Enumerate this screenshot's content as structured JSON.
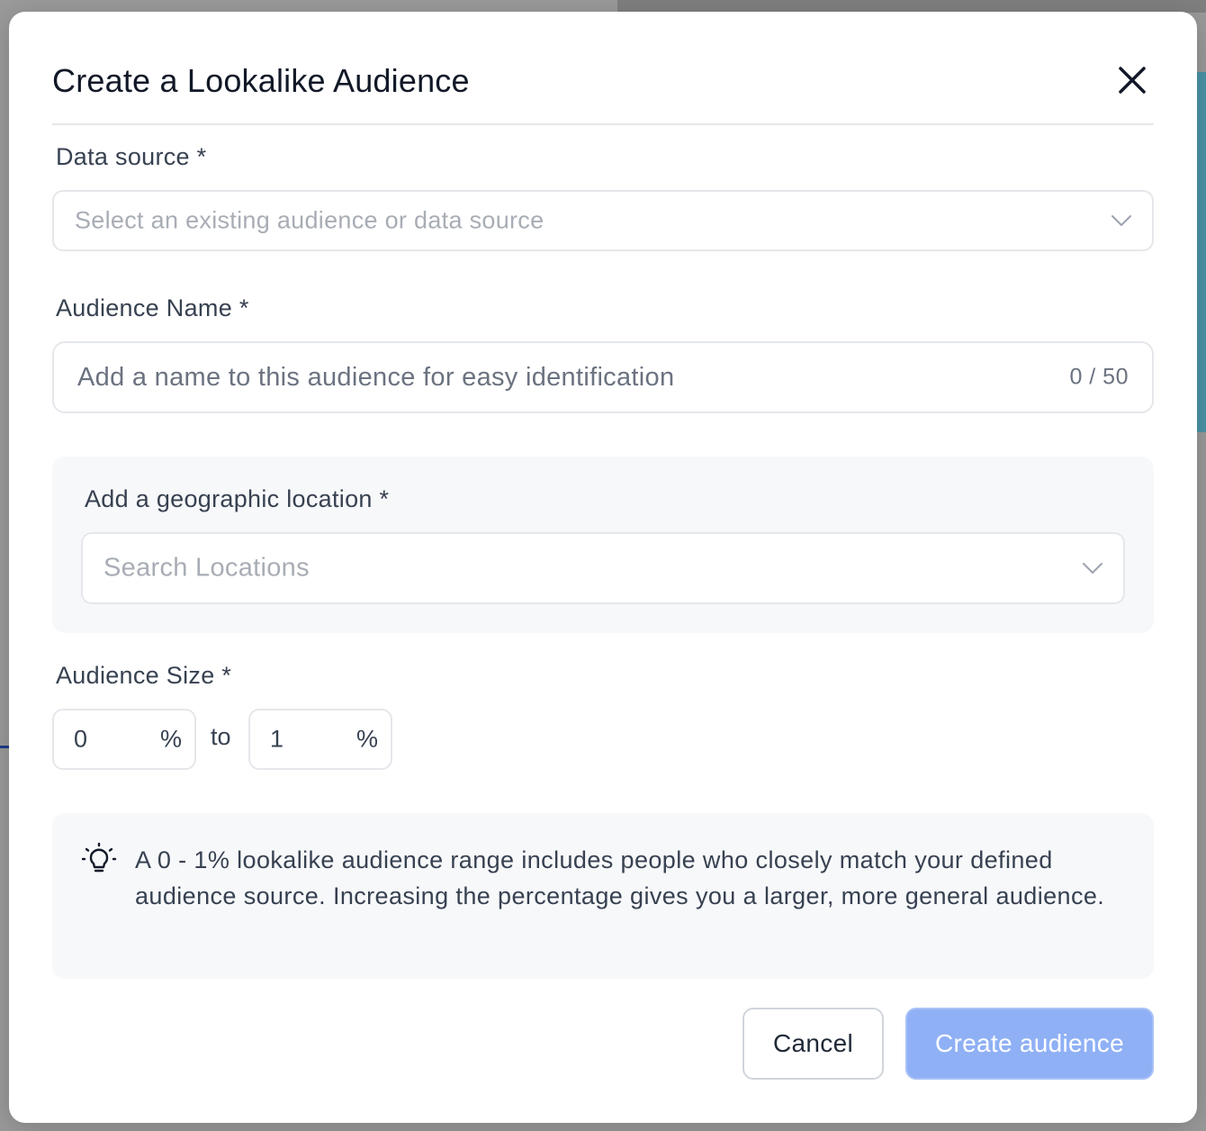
{
  "modal": {
    "title": "Create a Lookalike Audience"
  },
  "data_source": {
    "label": "Data source *",
    "placeholder": "Select an existing audience or data source"
  },
  "audience_name": {
    "label": "Audience Name *",
    "placeholder": "Add a name to this audience for easy identification",
    "value": "",
    "char_count": "0 / 50"
  },
  "location": {
    "label": "Add a geographic location *",
    "placeholder": "Search Locations"
  },
  "audience_size": {
    "label": "Audience Size *",
    "min_value": "0",
    "max_value": "1",
    "unit": "%",
    "separator": "to"
  },
  "info": {
    "text": "A 0 - 1% lookalike audience range includes people who closely match your defined audience source. Increasing the percentage gives you a larger, more general audience."
  },
  "buttons": {
    "cancel_label": "Cancel",
    "create_label": "Create audience"
  },
  "icons": {
    "close": "close-icon",
    "chevron": "chevron-down-icon",
    "bulb": "lightbulb-icon"
  },
  "colors": {
    "primary_disabled": "#8fb0f5",
    "panel_bg": "#f7f8fa",
    "border": "#e5e7eb"
  }
}
